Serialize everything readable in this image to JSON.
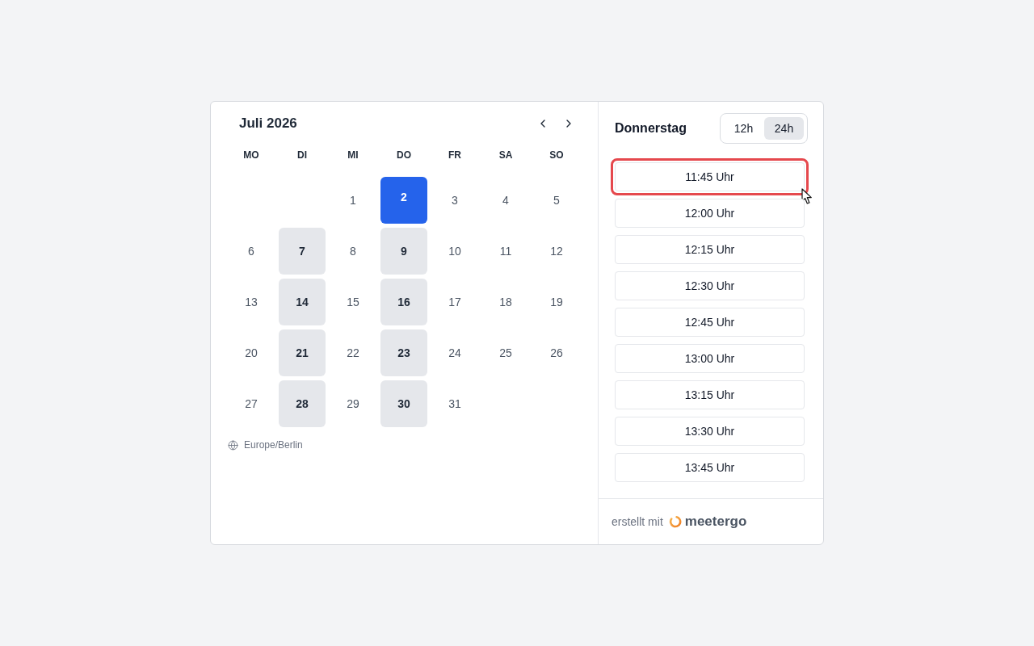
{
  "calendar": {
    "month_title": "Juli 2026",
    "weekdays": [
      "MO",
      "DI",
      "MI",
      "DO",
      "FR",
      "SA",
      "SO"
    ],
    "days": [
      {
        "kind": "blank"
      },
      {
        "kind": "blank"
      },
      {
        "kind": "day",
        "label": "1",
        "available": false,
        "selected": false
      },
      {
        "kind": "day",
        "label": "2",
        "available": true,
        "selected": true
      },
      {
        "kind": "day",
        "label": "3",
        "available": false,
        "selected": false
      },
      {
        "kind": "day",
        "label": "4",
        "available": false,
        "selected": false
      },
      {
        "kind": "day",
        "label": "5",
        "available": false,
        "selected": false
      },
      {
        "kind": "day",
        "label": "6",
        "available": false,
        "selected": false
      },
      {
        "kind": "day",
        "label": "7",
        "available": true,
        "selected": false
      },
      {
        "kind": "day",
        "label": "8",
        "available": false,
        "selected": false
      },
      {
        "kind": "day",
        "label": "9",
        "available": true,
        "selected": false
      },
      {
        "kind": "day",
        "label": "10",
        "available": false,
        "selected": false
      },
      {
        "kind": "day",
        "label": "11",
        "available": false,
        "selected": false
      },
      {
        "kind": "day",
        "label": "12",
        "available": false,
        "selected": false
      },
      {
        "kind": "day",
        "label": "13",
        "available": false,
        "selected": false
      },
      {
        "kind": "day",
        "label": "14",
        "available": true,
        "selected": false
      },
      {
        "kind": "day",
        "label": "15",
        "available": false,
        "selected": false
      },
      {
        "kind": "day",
        "label": "16",
        "available": true,
        "selected": false
      },
      {
        "kind": "day",
        "label": "17",
        "available": false,
        "selected": false
      },
      {
        "kind": "day",
        "label": "18",
        "available": false,
        "selected": false
      },
      {
        "kind": "day",
        "label": "19",
        "available": false,
        "selected": false
      },
      {
        "kind": "day",
        "label": "20",
        "available": false,
        "selected": false
      },
      {
        "kind": "day",
        "label": "21",
        "available": true,
        "selected": false
      },
      {
        "kind": "day",
        "label": "22",
        "available": false,
        "selected": false
      },
      {
        "kind": "day",
        "label": "23",
        "available": true,
        "selected": false
      },
      {
        "kind": "day",
        "label": "24",
        "available": false,
        "selected": false
      },
      {
        "kind": "day",
        "label": "25",
        "available": false,
        "selected": false
      },
      {
        "kind": "day",
        "label": "26",
        "available": false,
        "selected": false
      },
      {
        "kind": "day",
        "label": "27",
        "available": false,
        "selected": false
      },
      {
        "kind": "day",
        "label": "28",
        "available": true,
        "selected": false
      },
      {
        "kind": "day",
        "label": "29",
        "available": false,
        "selected": false
      },
      {
        "kind": "day",
        "label": "30",
        "available": true,
        "selected": false
      },
      {
        "kind": "day",
        "label": "31",
        "available": false,
        "selected": false
      }
    ],
    "timezone": "Europe/Berlin"
  },
  "times": {
    "day_title": "Donnerstag",
    "format_options": [
      {
        "label": "12h",
        "selected": false
      },
      {
        "label": "24h",
        "selected": true
      }
    ],
    "slots": [
      {
        "label": "11:45 Uhr",
        "highlighted": true
      },
      {
        "label": "12:00 Uhr",
        "highlighted": false
      },
      {
        "label": "12:15 Uhr",
        "highlighted": false
      },
      {
        "label": "12:30 Uhr",
        "highlighted": false
      },
      {
        "label": "12:45 Uhr",
        "highlighted": false
      },
      {
        "label": "13:00 Uhr",
        "highlighted": false
      },
      {
        "label": "13:15 Uhr",
        "highlighted": false
      },
      {
        "label": "13:30 Uhr",
        "highlighted": false
      },
      {
        "label": "13:45 Uhr",
        "highlighted": false
      }
    ]
  },
  "footer": {
    "prefix": "erstellt mit",
    "brand": "meetergo"
  }
}
